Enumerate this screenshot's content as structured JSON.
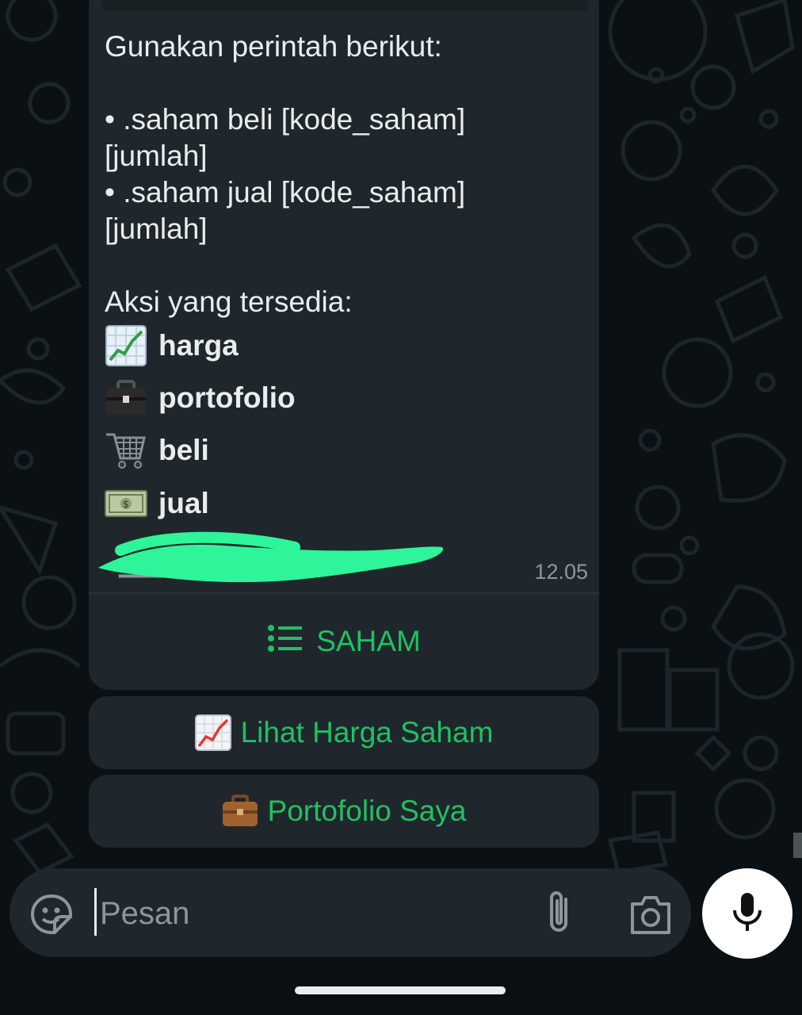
{
  "message": {
    "lines": [
      "Gunakan perintah berikut:",
      "",
      "• .saham beli [kode_saham]",
      "[jumlah]",
      "• .saham jual [kode_saham]",
      "[jumlah]"
    ],
    "actions_title": "Aksi yang tersedia:",
    "actions": [
      {
        "icon": "chart-increasing-icon",
        "label": "harga"
      },
      {
        "icon": "briefcase-icon",
        "label": "portofolio"
      },
      {
        "icon": "shopping-cart-icon",
        "label": "beli"
      },
      {
        "icon": "dollar-banknote-icon",
        "label": "jual"
      }
    ],
    "timestamp": "12.05"
  },
  "list_button": {
    "icon": "list-icon",
    "label": "SAHAM"
  },
  "quick_replies": [
    {
      "icon": "chart-increasing-icon",
      "label": "Lihat Harga Saham"
    },
    {
      "icon": "briefcase-icon",
      "label": "Portofolio Saya"
    }
  ],
  "composer": {
    "placeholder": "Pesan",
    "icons": [
      "sticker-icon",
      "paperclip-icon",
      "camera-icon",
      "microphone-icon"
    ]
  },
  "colors": {
    "background": "#0b1014",
    "bubble": "#1f272c",
    "accent": "#21c063",
    "text": "#e9edef",
    "muted": "#8c979d",
    "redaction": "#2ef59a"
  }
}
